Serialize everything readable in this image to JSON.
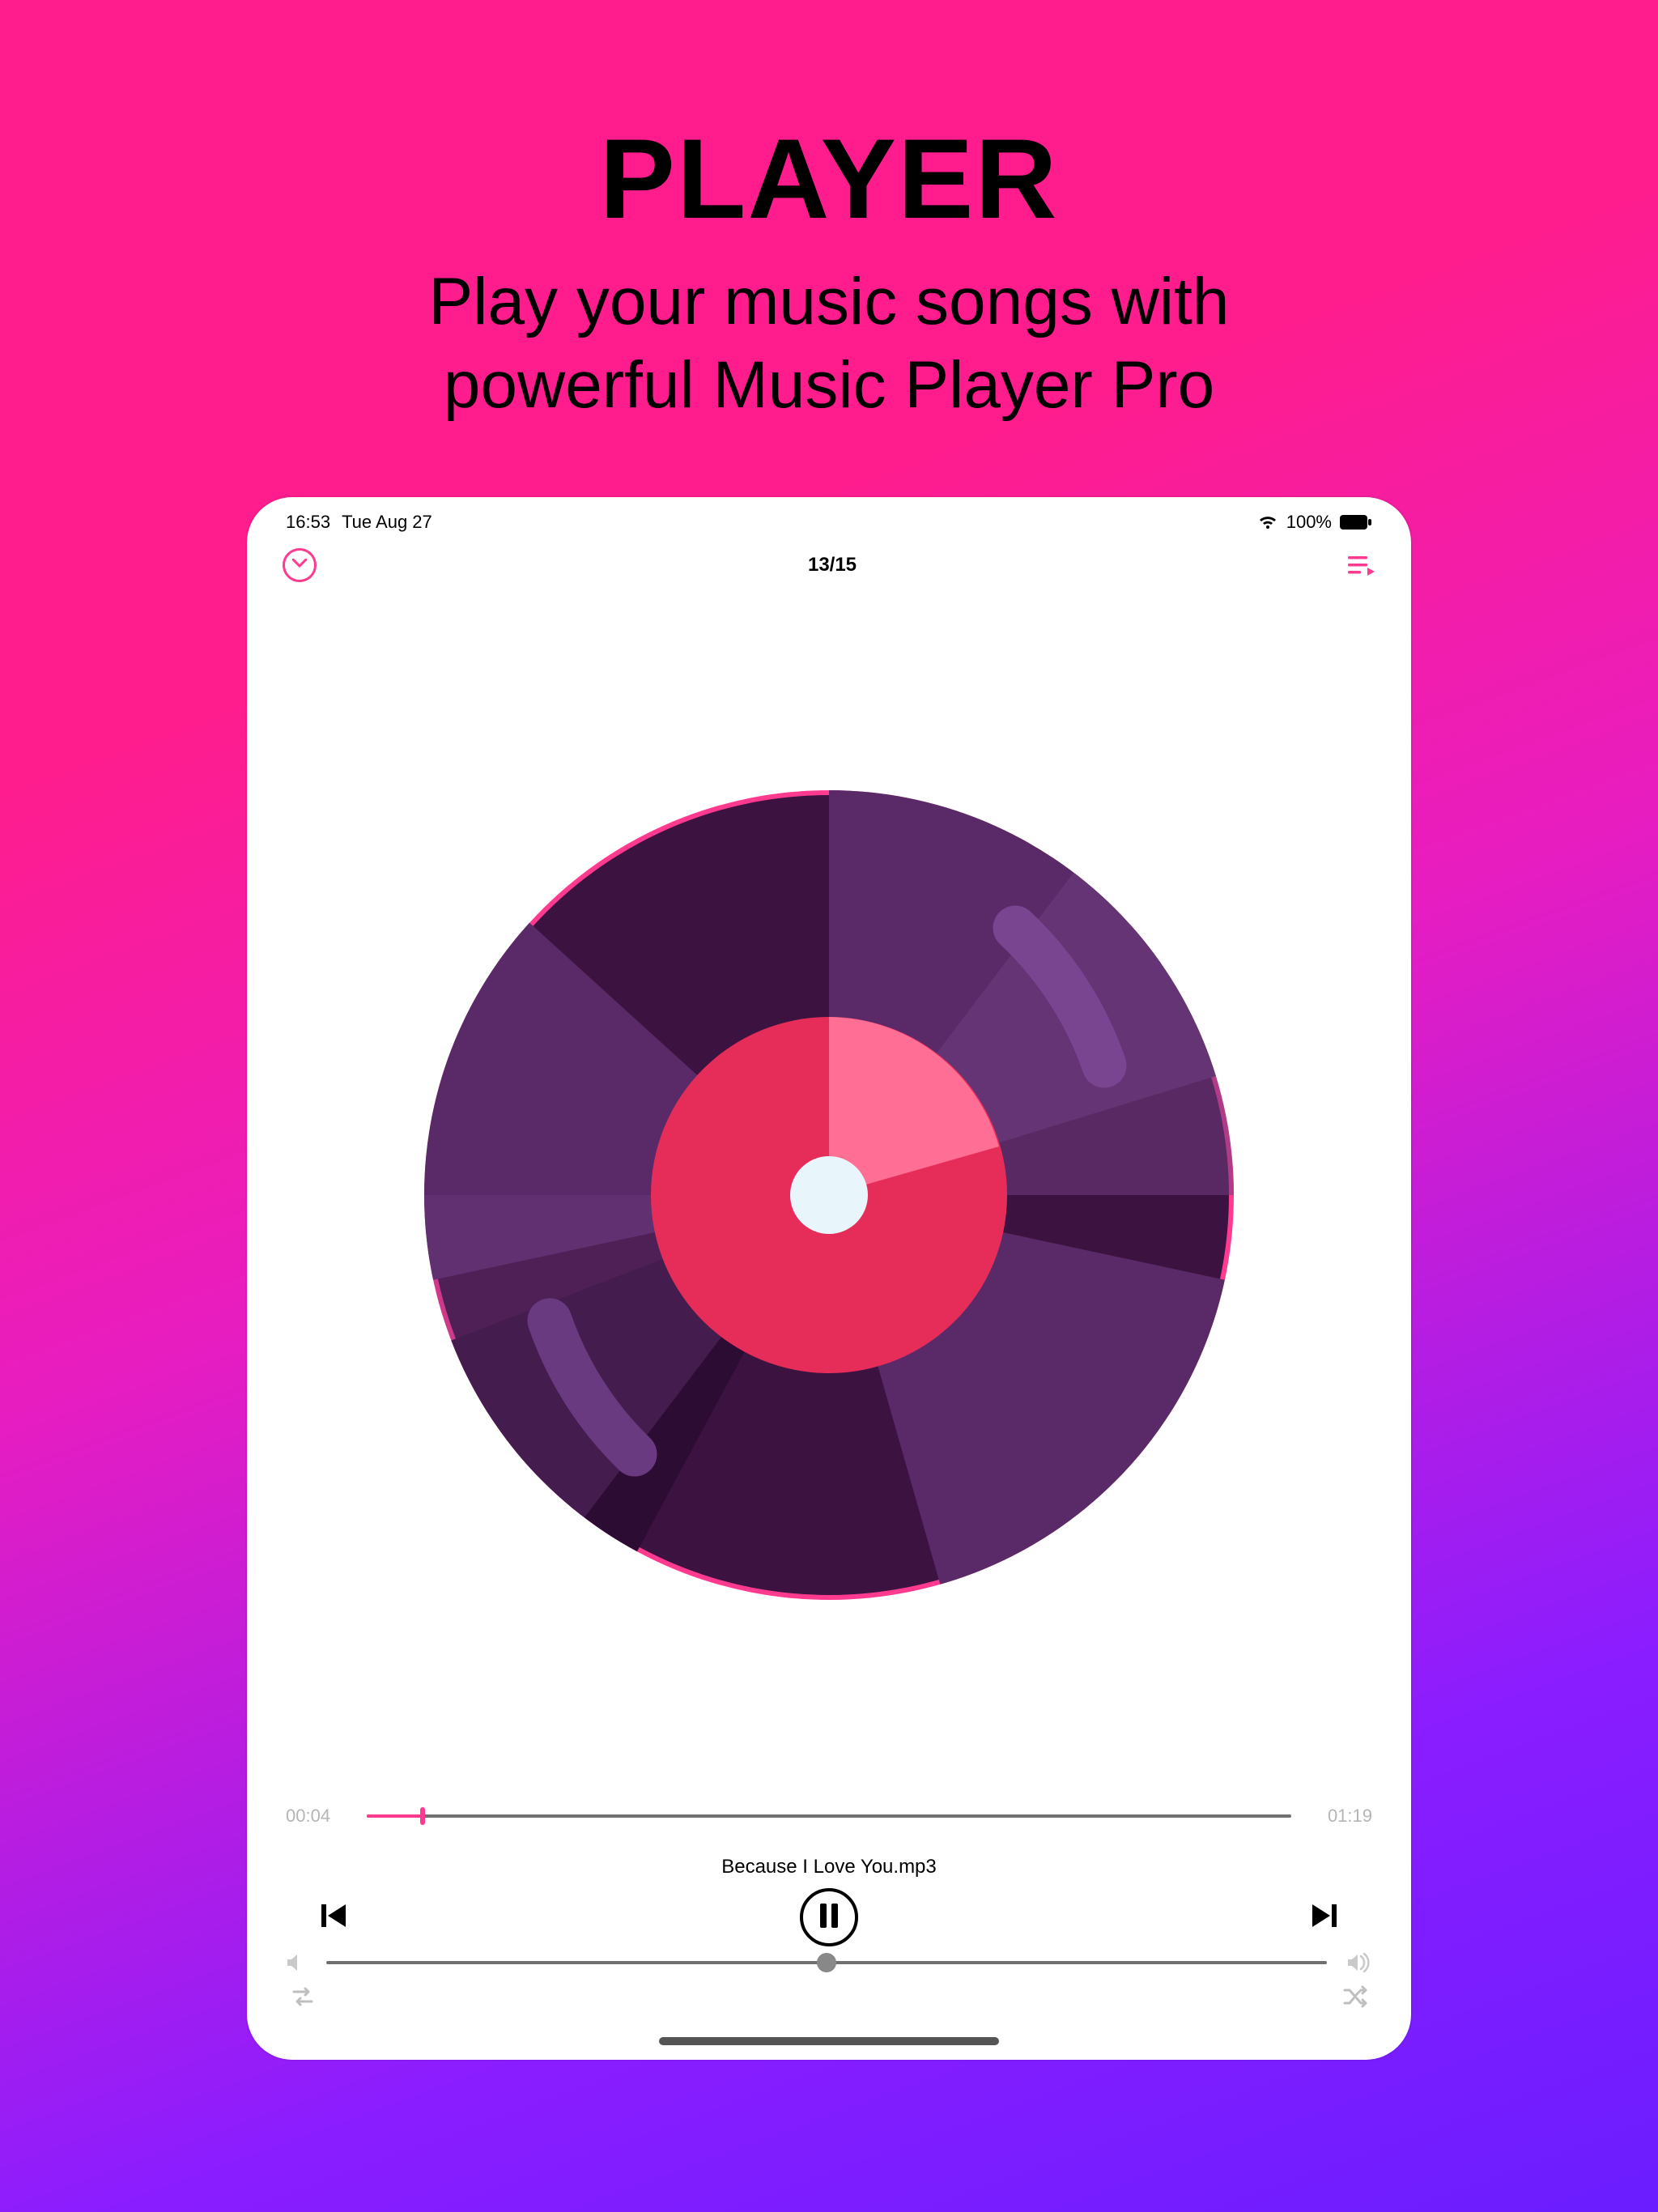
{
  "promo": {
    "title": "PLAYER",
    "subtitle_line1": "Play your music songs with",
    "subtitle_line2": "powerful Music Player Pro"
  },
  "status": {
    "time": "16:53",
    "date": "Tue Aug 27",
    "battery_percent": "100%"
  },
  "player": {
    "track_position": "13/15",
    "elapsed": "00:04",
    "duration": "01:19",
    "song_title": "Because I Love You.mp3",
    "progress_percent": 6,
    "volume_percent": 50
  },
  "icons": {
    "collapse": "chevron-down-icon",
    "queue": "queue-icon",
    "prev": "skip-previous-icon",
    "pause": "pause-icon",
    "next": "skip-next-icon",
    "vol_low": "volume-low-icon",
    "vol_high": "volume-high-icon",
    "repeat": "repeat-icon",
    "shuffle": "shuffle-icon",
    "wifi": "wifi-icon",
    "battery": "battery-icon"
  },
  "colors": {
    "accent": "#ff3a8f",
    "grad_top": "#ff1d8e",
    "grad_bottom": "#6a1dff"
  }
}
